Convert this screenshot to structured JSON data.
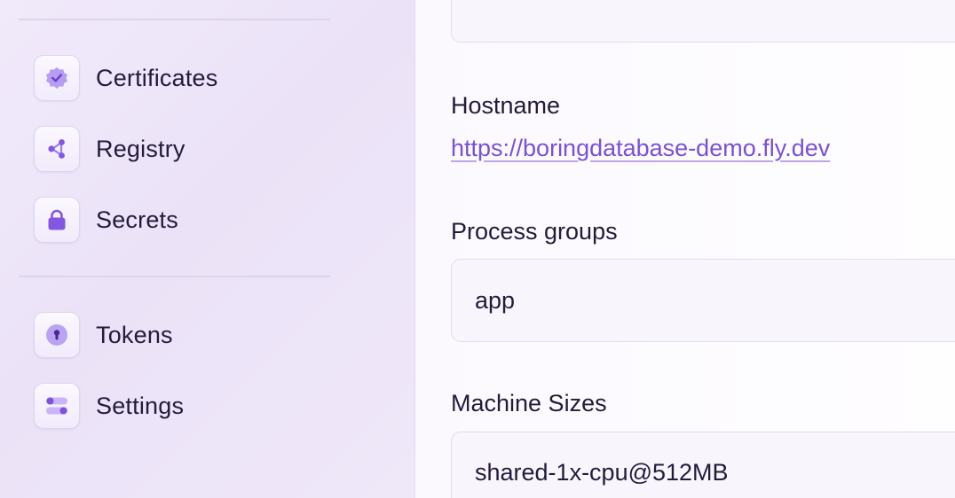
{
  "sidebar": {
    "items": [
      {
        "label": "Certificates",
        "icon": "badge-check-icon"
      },
      {
        "label": "Registry",
        "icon": "share-nodes-icon"
      },
      {
        "label": "Secrets",
        "icon": "lock-icon"
      },
      {
        "label": "Tokens",
        "icon": "keyhole-icon"
      },
      {
        "label": "Settings",
        "icon": "toggles-icon"
      }
    ]
  },
  "main": {
    "hostname": {
      "label": "Hostname",
      "url": "https://boringdatabase-demo.fly.dev"
    },
    "process_groups": {
      "label": "Process groups",
      "value": "app"
    },
    "machine_sizes": {
      "label": "Machine Sizes",
      "value": "shared-1x-cpu@512MB"
    }
  },
  "colors": {
    "accent": "#7b4fd8",
    "icon_fill": "#8b63e8",
    "text": "#241a3b",
    "sidebar_bg": "#ede5f8"
  }
}
